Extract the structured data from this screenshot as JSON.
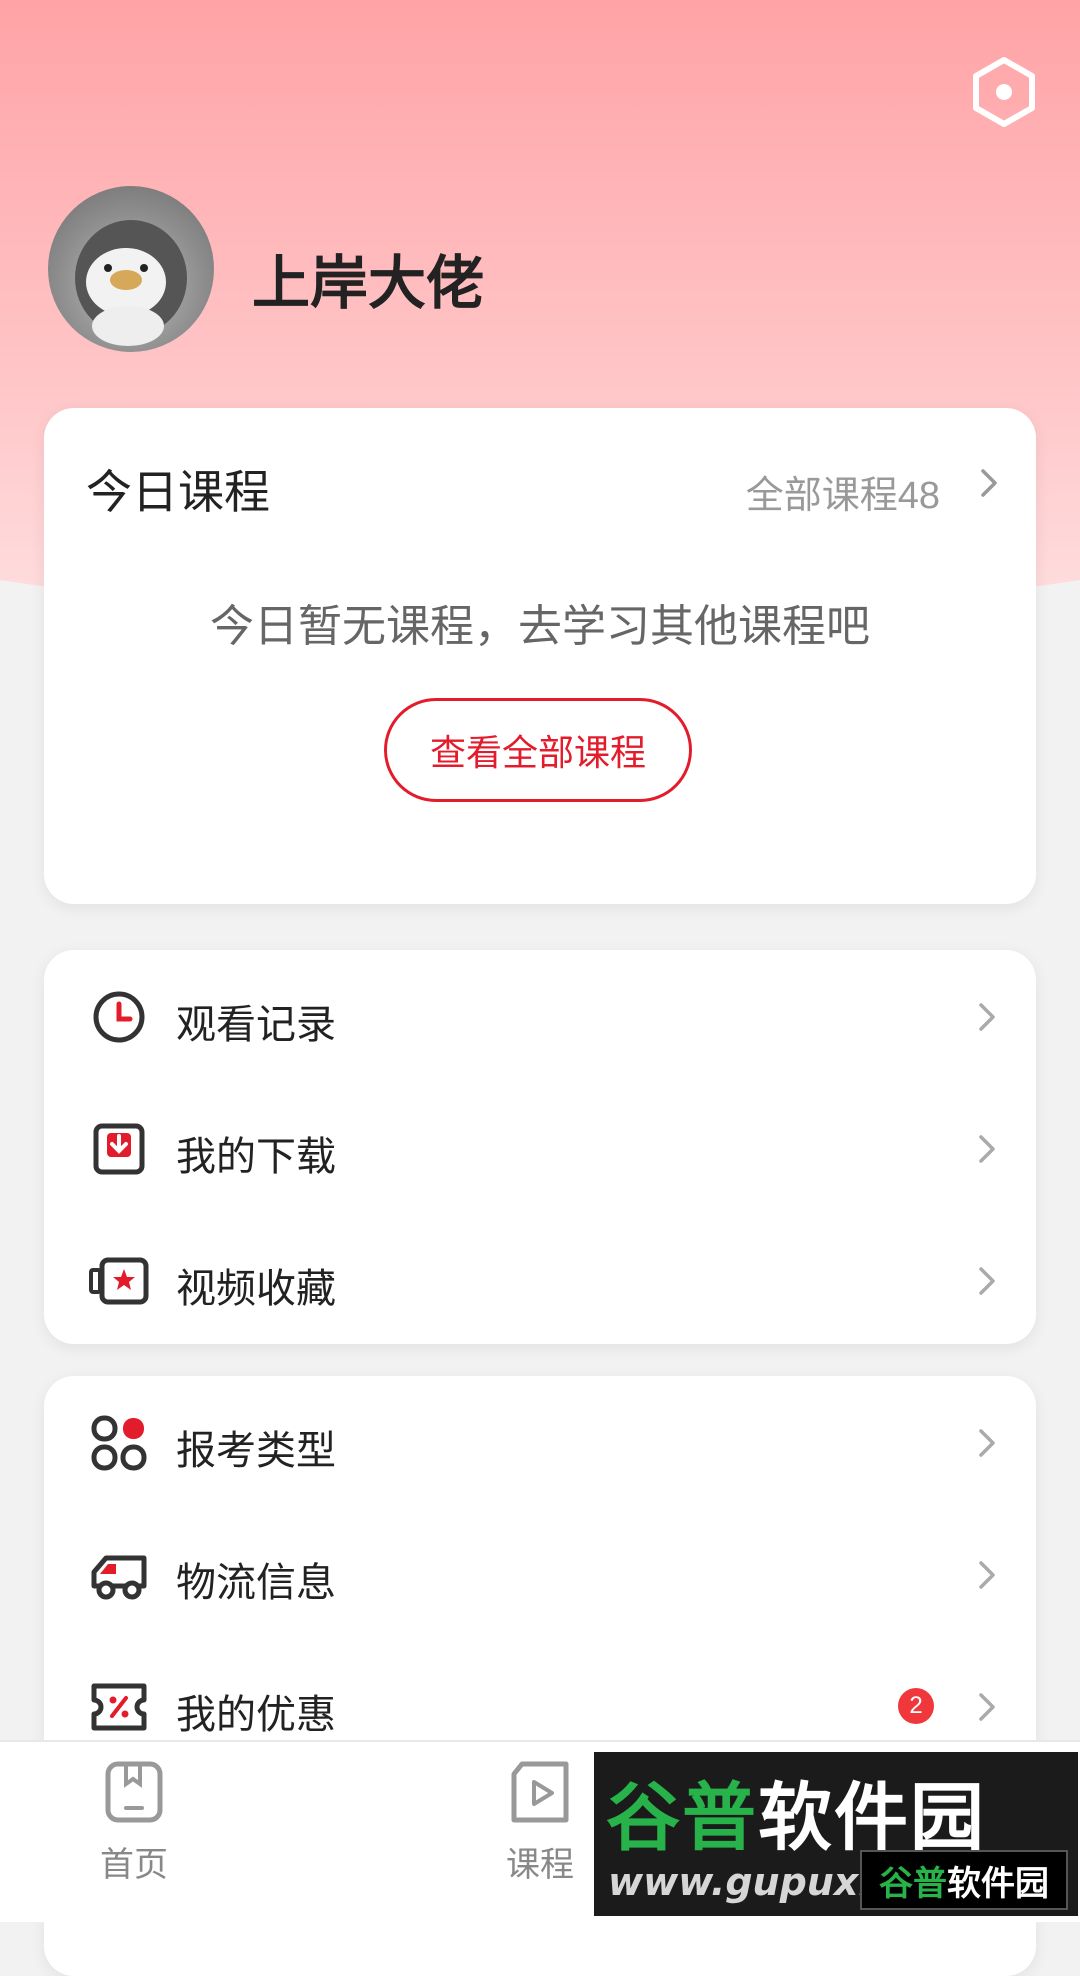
{
  "profile": {
    "username": "上岸大佬"
  },
  "today_course": {
    "title": "今日课程",
    "all_courses_label": "全部课程48",
    "empty_message": "今日暂无课程，去学习其他课程吧",
    "view_all_button": "查看全部课程"
  },
  "menu_group_1": [
    {
      "label": "观看记录",
      "icon": "clock-icon"
    },
    {
      "label": "我的下载",
      "icon": "download-icon"
    },
    {
      "label": "视频收藏",
      "icon": "star-video-icon"
    }
  ],
  "menu_group_2": [
    {
      "label": "报考类型",
      "icon": "grid-icon"
    },
    {
      "label": "物流信息",
      "icon": "truck-icon"
    },
    {
      "label": "我的优惠",
      "icon": "coupon-icon",
      "badge": "2"
    }
  ],
  "tabbar": [
    {
      "label": "首页",
      "icon": "home-book-icon"
    },
    {
      "label": "课程",
      "icon": "course-play-icon"
    }
  ],
  "watermark": {
    "line1_a": "谷普",
    "line1_b": "软件园",
    "line2": "www.gupuxiazai.com",
    "badge_a": "谷普",
    "badge_b": "软件园"
  },
  "colors": {
    "accent": "#e31c2c",
    "header_top": "#ffa3a6",
    "badge": "#f0383c"
  }
}
